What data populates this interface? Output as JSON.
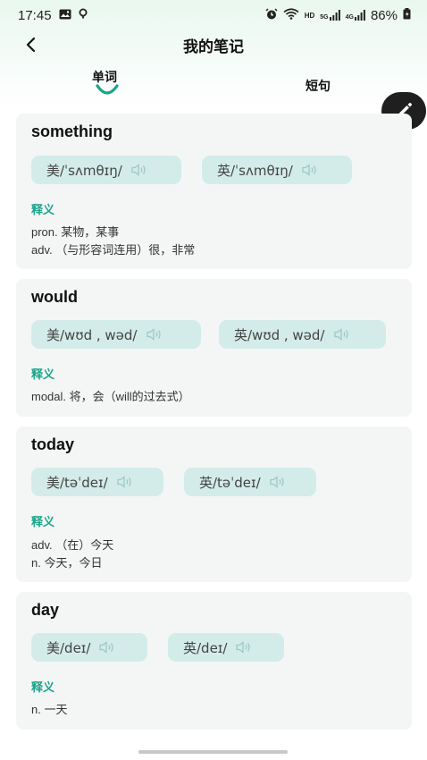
{
  "status": {
    "time": "17:45",
    "network": "HD",
    "signal_5g": "5G",
    "signal_4g": "4G",
    "battery": "86%"
  },
  "header": {
    "title": "我的笔记"
  },
  "tabs": [
    {
      "label": "单词",
      "selected": true
    },
    {
      "label": "短句",
      "selected": false
    }
  ],
  "colors": {
    "accent": "#1aa38a",
    "pill": "#d3ece9",
    "card": "#f4f6f5",
    "fab": "#1f1f1f"
  },
  "cards": [
    {
      "word": "something",
      "us": "美/ˈsʌmθɪŋ/",
      "uk": "英/ˈsʌmθɪŋ/",
      "def_label": "释义",
      "defs": [
        "pron. 某物，某事",
        "adv. （与形容词连用）很，非常"
      ]
    },
    {
      "word": "would",
      "us": "美/wʊd , wəd/",
      "uk": "英/wʊd , wəd/",
      "def_label": "释义",
      "defs": [
        "modal. 将，会（will的过去式）"
      ]
    },
    {
      "word": "today",
      "us": "美/təˈdeɪ/",
      "uk": "英/təˈdeɪ/",
      "def_label": "释义",
      "defs": [
        "adv. （在）今天",
        "n. 今天，今日"
      ]
    },
    {
      "word": "day",
      "us": "美/deɪ/",
      "uk": "英/deɪ/",
      "def_label": "释义",
      "defs": [
        "n. 一天"
      ]
    }
  ]
}
